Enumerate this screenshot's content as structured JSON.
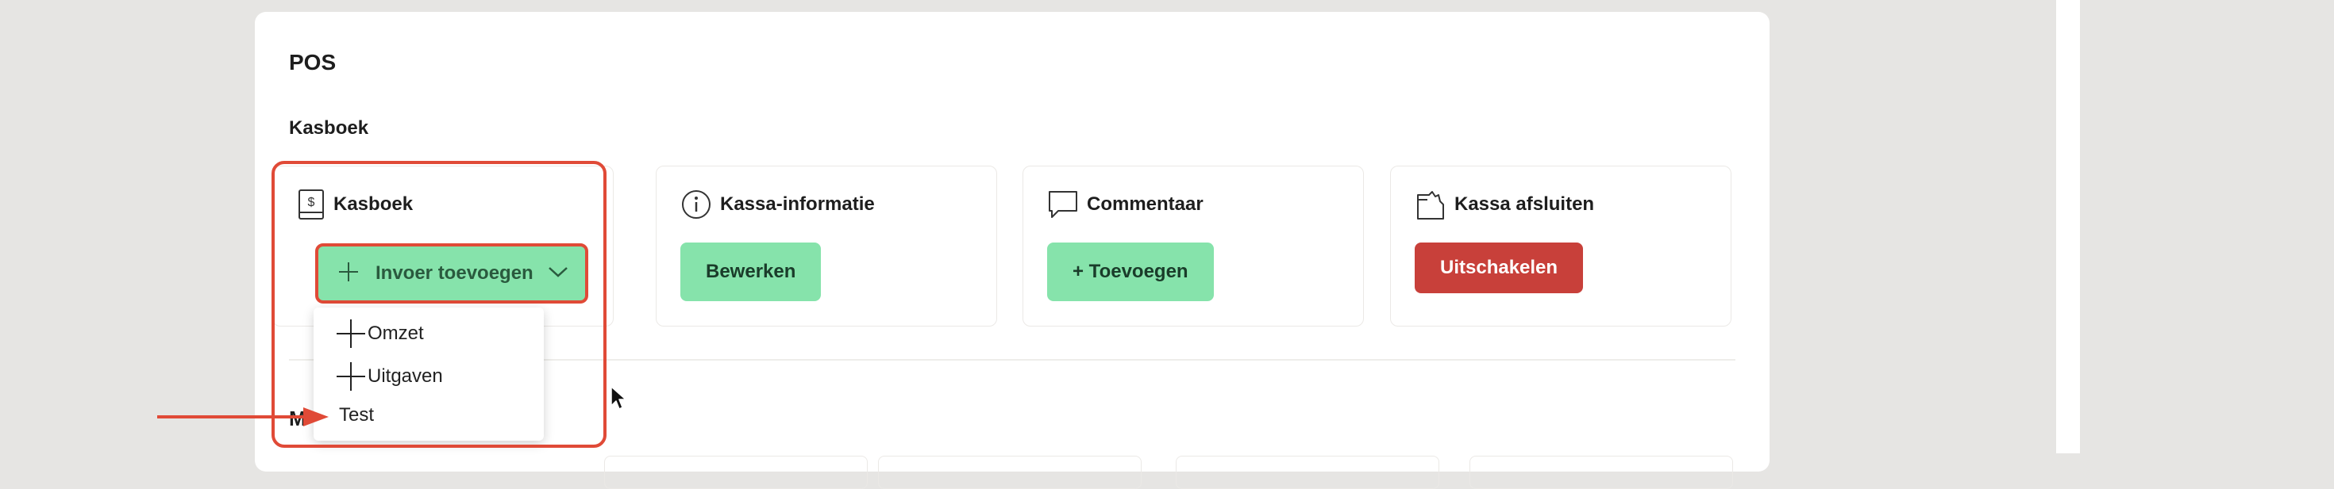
{
  "panel": {
    "title": "POS"
  },
  "section": {
    "label": "Kasboek"
  },
  "cards": [
    {
      "title": "Kasboek",
      "icon": "ledger-dollar-icon"
    },
    {
      "title": "Kassa-informatie",
      "icon": "info-icon",
      "button": "Bewerken"
    },
    {
      "title": "Commentaar",
      "icon": "comment-icon",
      "button": "+ Toevoegen"
    },
    {
      "title": "Kassa afsluiten",
      "icon": "register-close-icon",
      "button": "Uitschakelen"
    }
  ],
  "split_button": {
    "label": "Invoer toevoegen",
    "icon": "plus-icon",
    "caret": "chevron-down-icon"
  },
  "dropdown": {
    "items": [
      {
        "label": "Omzet",
        "icon": "plus-icon"
      },
      {
        "label": "Uitgaven",
        "icon": "plus-icon"
      },
      {
        "label": "Test"
      }
    ]
  },
  "next_section": {
    "label_partial": "M"
  },
  "colors": {
    "accent_green": "#86e3ab",
    "danger_red": "#c8403a",
    "annotation_red": "#e04a37"
  }
}
